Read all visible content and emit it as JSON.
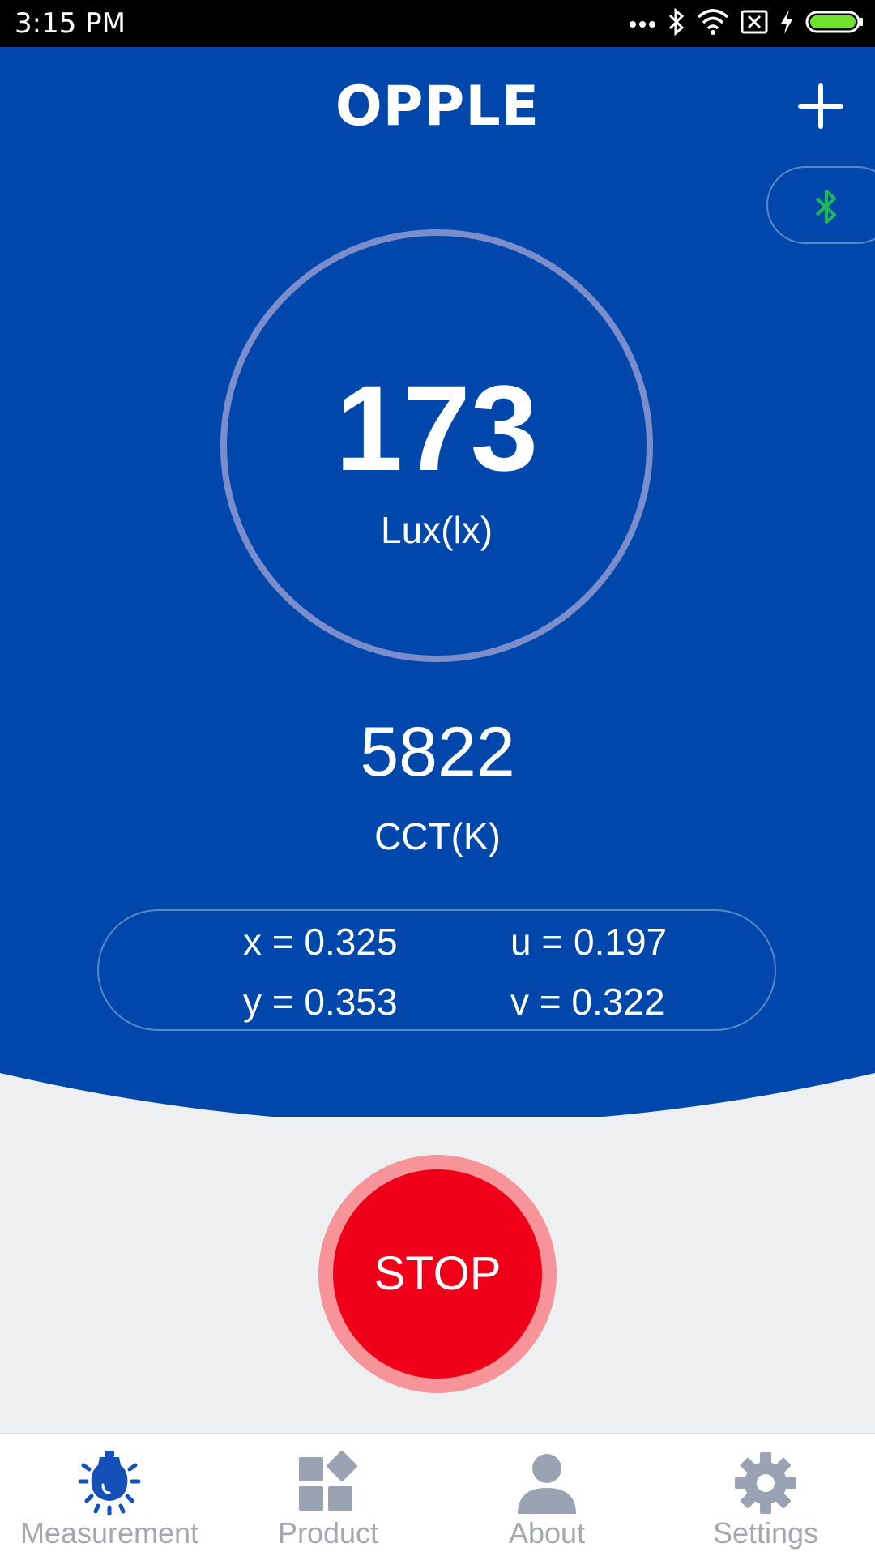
{
  "status_bar": {
    "time": "3:15 PM",
    "icons": [
      "more-dots-icon",
      "bluetooth-icon",
      "wifi-icon",
      "no-sim-icon",
      "charging-bolt-icon",
      "battery-icon"
    ]
  },
  "header": {
    "logo_text": "OPPLE",
    "add_icon": "plus-icon",
    "bluetooth_icon": "bluetooth-icon"
  },
  "measurement": {
    "lux_value": "173",
    "lux_unit": "Lux(lx)",
    "cct_value": "5822",
    "cct_unit": "CCT(K)",
    "chromaticity": {
      "x": "x = 0.325",
      "u": "u = 0.197",
      "y": "y = 0.353",
      "v": "v = 0.322"
    }
  },
  "stop_button": {
    "label": "STOP"
  },
  "bottom_nav": {
    "items": [
      {
        "label": "Measurement",
        "icon": "lightbulb-icon",
        "active": true
      },
      {
        "label": "Product",
        "icon": "grid-icon",
        "active": false
      },
      {
        "label": "About",
        "icon": "person-icon",
        "active": false
      },
      {
        "label": "Settings",
        "icon": "gear-icon",
        "active": false
      }
    ]
  },
  "colors": {
    "primary_blue": "#0047ab",
    "stop_red": "#ef0018",
    "stop_ring": "#f6949a",
    "bluetooth_green": "#1db954",
    "active_nav_icon": "#1550b8",
    "inactive_nav_icon": "#9aa3b3",
    "background": "#eeeff1"
  }
}
